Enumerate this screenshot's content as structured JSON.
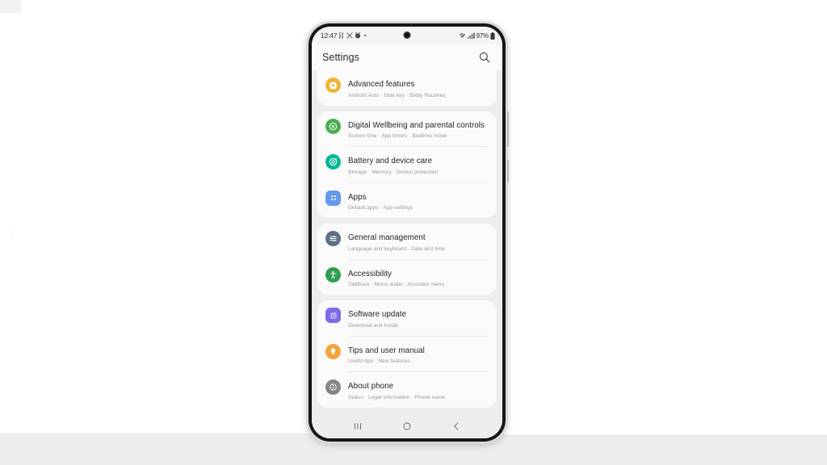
{
  "page": {
    "background_color": "#ffffff",
    "accent_highlight_color": "#e60000"
  },
  "carousel": {
    "prev_label": "Previous"
  },
  "phone": {
    "status_bar": {
      "time": "12:47",
      "left_icons": [
        "dnd-icon",
        "no-sim-icon",
        "alarm-icon",
        "dot-icon"
      ],
      "wifi_icon": "wifi-icon",
      "signal_icon": "signal-bars-icon",
      "battery_percent": "97%",
      "battery_icon": "battery-icon"
    },
    "header": {
      "title": "Settings",
      "search_icon": "search-icon"
    },
    "nav_bar": {
      "recents_label": "Recents",
      "home_label": "Home",
      "back_label": "Back"
    }
  },
  "settings": {
    "groups": [
      {
        "id": "group-advanced",
        "items": [
          {
            "id": "advanced-features",
            "title": "Advanced features",
            "subtitle": "Android Auto  ·  Side key  ·  Bixby Routines",
            "icon": "advanced-features-icon",
            "icon_color": "#f0b435",
            "icon_shape": "circle",
            "highlighted": false
          }
        ]
      },
      {
        "id": "group-wellbeing",
        "items": [
          {
            "id": "digital-wellbeing",
            "title": "Digital Wellbeing and parental controls",
            "subtitle": "Screen time  ·  App timers  ·  Bedtime mode",
            "icon": "digital-wellbeing-icon",
            "icon_color": "#4caf50",
            "icon_shape": "circle",
            "highlighted": false
          },
          {
            "id": "battery-device-care",
            "title": "Battery and device care",
            "subtitle": "Storage  ·  Memory  ·  Device protection",
            "icon": "battery-care-icon",
            "icon_color": "#00b894",
            "icon_shape": "circle",
            "highlighted": false
          },
          {
            "id": "apps",
            "title": "Apps",
            "subtitle": "Default apps  ·  App settings",
            "icon": "apps-grid-icon",
            "icon_color": "#6699e8",
            "icon_shape": "rounded-square",
            "highlighted": false
          }
        ]
      },
      {
        "id": "group-management",
        "items": [
          {
            "id": "general-management",
            "title": "General management",
            "subtitle": "Language and keyboard  ·  Date and time",
            "icon": "sliders-icon",
            "icon_color": "#5d6f87",
            "icon_shape": "circle",
            "highlighted": false
          },
          {
            "id": "accessibility",
            "title": "Accessibility",
            "subtitle": "TalkBack  ·  Mono audio  ·  Assistant menu",
            "icon": "accessibility-icon",
            "icon_color": "#2e9e52",
            "icon_shape": "circle",
            "highlighted": false
          }
        ]
      },
      {
        "id": "group-about",
        "items": [
          {
            "id": "software-update",
            "title": "Software update",
            "subtitle": "Download and install",
            "icon": "software-update-icon",
            "icon_color": "#7d6ce8",
            "icon_shape": "rounded-square",
            "highlighted": false
          },
          {
            "id": "tips-user-manual",
            "title": "Tips and user manual",
            "subtitle": "Useful tips  ·  New features",
            "icon": "lightbulb-icon",
            "icon_color": "#f5a23a",
            "icon_shape": "circle",
            "highlighted": false
          },
          {
            "id": "about-phone",
            "title": "About phone",
            "subtitle": "Status  ·  Legal information  ·  Phone name",
            "icon": "info-icon",
            "icon_color": "#868686",
            "icon_shape": "circle",
            "highlighted": true
          }
        ]
      }
    ]
  }
}
